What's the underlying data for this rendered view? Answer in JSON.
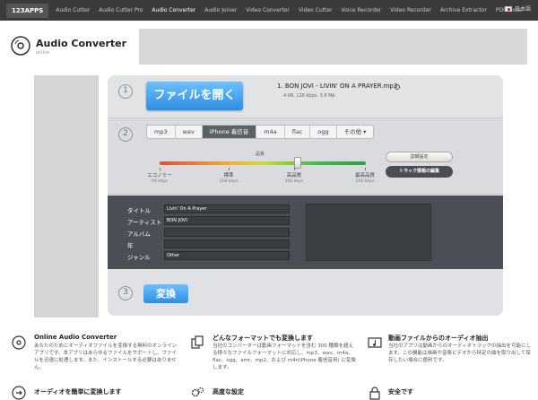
{
  "nav": {
    "brand": "123APPS",
    "items": [
      "Audio Cutter",
      "Audio Cutter Pro",
      "Audio Converter",
      "Audio Joiner",
      "Video Converter",
      "Video Cutter",
      "Voice Recorder",
      "Video Recorder",
      "Archive Extractor",
      "PDF Tools"
    ],
    "active_index": 2,
    "language": "日本語"
  },
  "header": {
    "title": "Audio Converter",
    "subtitle": "online"
  },
  "step1": {
    "number": "1",
    "open_button": "ファイルを開く",
    "file_name": "1. BON JOVI - LIVIN' ON A PRAYER.mp3",
    "file_meta": "4:08, 128 kbps, 3.8 Mb"
  },
  "step2": {
    "number": "2",
    "formats": [
      "mp3",
      "wav",
      "iPhone 着信音",
      "m4a",
      "flac",
      "ogg",
      "その他"
    ],
    "selected_format": "iPhone 着信音",
    "quality_label": "品質",
    "quality_level_fraction": 0.67,
    "levels": [
      {
        "name": "エコノミー",
        "kbps": "64 kbps"
      },
      {
        "name": "標準",
        "kbps": "128 kbps"
      },
      {
        "name": "高品質",
        "kbps": "160 kbps"
      },
      {
        "name": "最高品質",
        "kbps": "256 kbps"
      }
    ],
    "detail_button": "詳細設定",
    "track_button": "トラック情報の編集"
  },
  "track": {
    "labels": {
      "title": "タイトル",
      "artist": "アーティスト",
      "album": "アルバム",
      "year": "年",
      "genre": "ジャンル"
    },
    "values": {
      "title": "Livin' On A Prayer",
      "artist": "BON JOVI",
      "album": "",
      "year": "",
      "genre": "Other"
    }
  },
  "step3": {
    "number": "3",
    "convert_button": "変換"
  },
  "features": [
    {
      "title": "Online Audio Converter",
      "text": "あなたのためにオーディオファイルを変換する無料のオンラインアプリです。本アプリはあらゆるファイルをサポートし、ファイルを迅速に処理します。また、インストールする必要はありません。",
      "icon": "disc-icon"
    },
    {
      "title": "どんなフォーマットでも変換します",
      "text": "当社のコンバーターは動画フォーマットを含む 300 種類を超える様々なファイルフォーマットに対応し、mp3、wav、m4a、flac、ogg、amr、mp2、および m4r(iPhone 着信音用) に変換します。",
      "icon": "documents-icon"
    },
    {
      "title": "動画ファイルからのオーディオ抽出",
      "text": "当社のアプリは動画からのオーディオトラックの抽出を可能にします。この機能は映画や音楽ビデオから特定の曲を取り出して保存したい場合に便利です。",
      "icon": "video-music-icon"
    },
    {
      "title": "オーディオを簡単に変換します",
      "icon": "disc-arrow-icon"
    },
    {
      "title": "高度な設定",
      "icon": "gears-icon"
    },
    {
      "title": "安全です",
      "icon": "lock-icon"
    }
  ]
}
